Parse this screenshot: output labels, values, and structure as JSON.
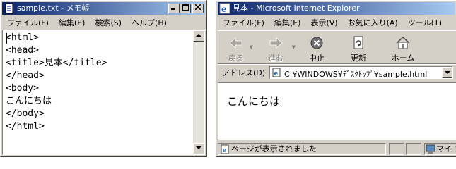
{
  "notepad": {
    "title": "sample.txt - メモ帳",
    "menu": [
      "ファイル(F)",
      "編集(E)",
      "検索(S)",
      "ヘルプ(H)"
    ],
    "lines": [
      "<html>",
      "<head>",
      "<title>見本</title>",
      "</head>",
      "<body>",
      "こんにちは",
      "</body>",
      "</html>"
    ]
  },
  "ie": {
    "title": "見本 - Microsoft Internet Explorer",
    "menu": [
      "ファイル(F)",
      "編集(E)",
      "表示(V)",
      "お気に入り(A)",
      "ツール(T)"
    ],
    "toolbar": {
      "back": "戻る",
      "forward": "進む",
      "stop": "中止",
      "refresh": "更新",
      "home": "ホーム"
    },
    "address_label": "アドレス(D)",
    "address_value": "C:¥WINDOWS¥ﾃﾞｽｸﾄｯﾌﾟ¥sample.html",
    "page_text": "こんにちは",
    "status_text": "ページが表示されました",
    "zone_text": "マイ コ"
  },
  "colors": {
    "title_active": "#0a246a",
    "face": "#d4d0c8"
  }
}
